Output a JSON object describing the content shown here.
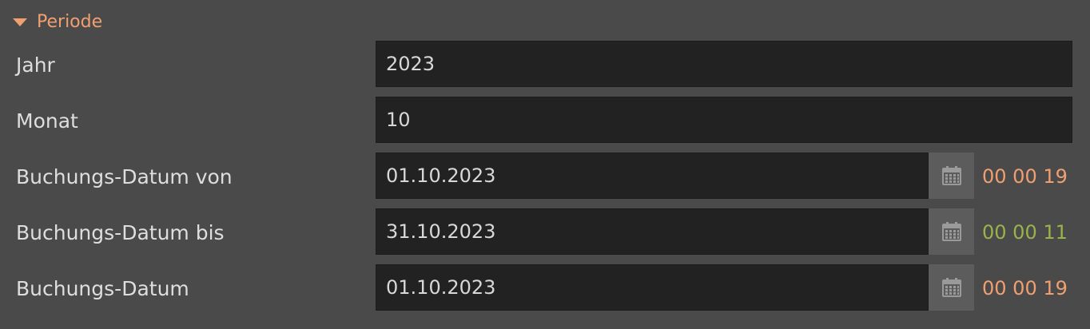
{
  "section": {
    "title": "Periode"
  },
  "fields": {
    "jahr": {
      "label": "Jahr",
      "value": "2023"
    },
    "monat": {
      "label": "Monat",
      "value": "10"
    },
    "datum_von": {
      "label": "Buchungs-Datum von",
      "value": "01.10.2023",
      "counter": "00 00 19",
      "counter_color": "#f0a070"
    },
    "datum_bis": {
      "label": "Buchungs-Datum bis",
      "value": "31.10.2023",
      "counter": "00 00 11",
      "counter_color": "#9ab34a"
    },
    "datum": {
      "label": "Buchungs-Datum",
      "value": "01.10.2023",
      "counter": "00 00 19",
      "counter_color": "#f0a070"
    }
  },
  "icons": {
    "section_toggle": "caret-down-icon",
    "date_picker": "calendar-icon"
  },
  "colors": {
    "background": "#4a4a4a",
    "input_background": "#222222",
    "accent": "#f0a070",
    "counter_green": "#9ab34a",
    "button_background": "#5c5c5c"
  }
}
